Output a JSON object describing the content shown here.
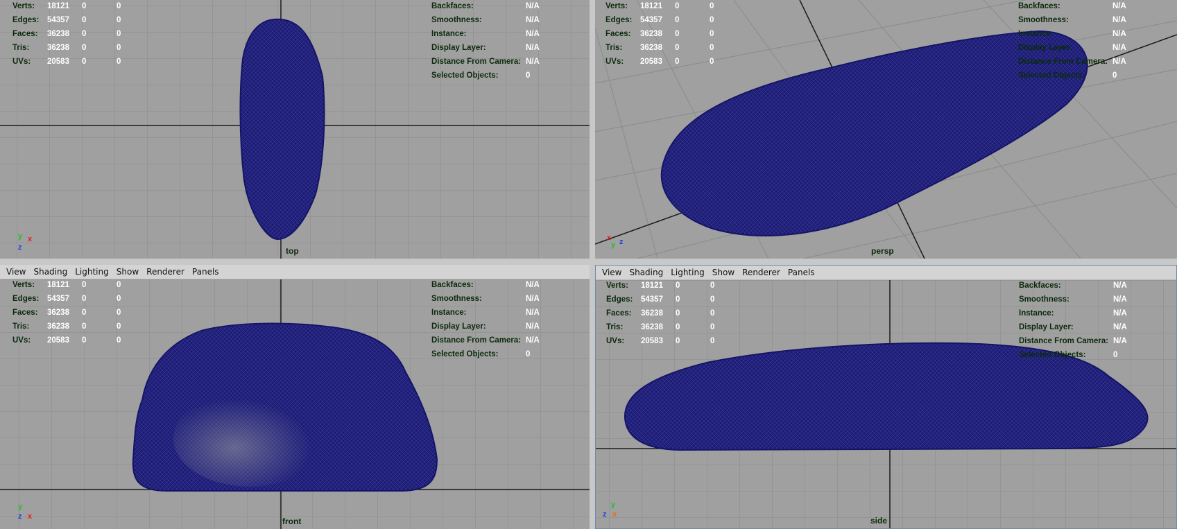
{
  "menu": [
    "View",
    "Shading",
    "Lighting",
    "Show",
    "Renderer",
    "Panels"
  ],
  "stats": [
    {
      "label": "Verts:",
      "v1": "18121",
      "v2": "0",
      "v3": "0"
    },
    {
      "label": "Edges:",
      "v1": "54357",
      "v2": "0",
      "v3": "0"
    },
    {
      "label": "Faces:",
      "v1": "36238",
      "v2": "0",
      "v3": "0"
    },
    {
      "label": "Tris:",
      "v1": "36238",
      "v2": "0",
      "v3": "0"
    },
    {
      "label": "UVs:",
      "v1": "20583",
      "v2": "0",
      "v3": "0"
    }
  ],
  "info": [
    {
      "label": "Backfaces:",
      "value": "N/A"
    },
    {
      "label": "Smoothness:",
      "value": "N/A"
    },
    {
      "label": "Instance:",
      "value": "N/A"
    },
    {
      "label": "Display Layer:",
      "value": "N/A"
    },
    {
      "label": "Distance From Camera:",
      "value": "N/A"
    },
    {
      "label": "Selected Objects:",
      "value": "0"
    }
  ],
  "viewports": {
    "top": {
      "camera": "top",
      "axis": [
        "y",
        "x",
        "z"
      ]
    },
    "persp": {
      "camera": "persp",
      "axis": [
        "x",
        "z",
        "y"
      ]
    },
    "front": {
      "camera": "front",
      "axis": [
        "y",
        "z",
        "x"
      ]
    },
    "side": {
      "camera": "side",
      "axis": [
        "y",
        "z",
        "x"
      ]
    }
  },
  "colors": {
    "viewport_bg": "#a0a0a0",
    "grid": "#8a8a8a",
    "axis_line": "#1a1a1a",
    "mesh": "#141467",
    "hud_label": "#0b2a0b",
    "hud_value": "#ffffff",
    "axis_x": "#e02020",
    "axis_y": "#20c020",
    "axis_z": "#2040e0"
  }
}
